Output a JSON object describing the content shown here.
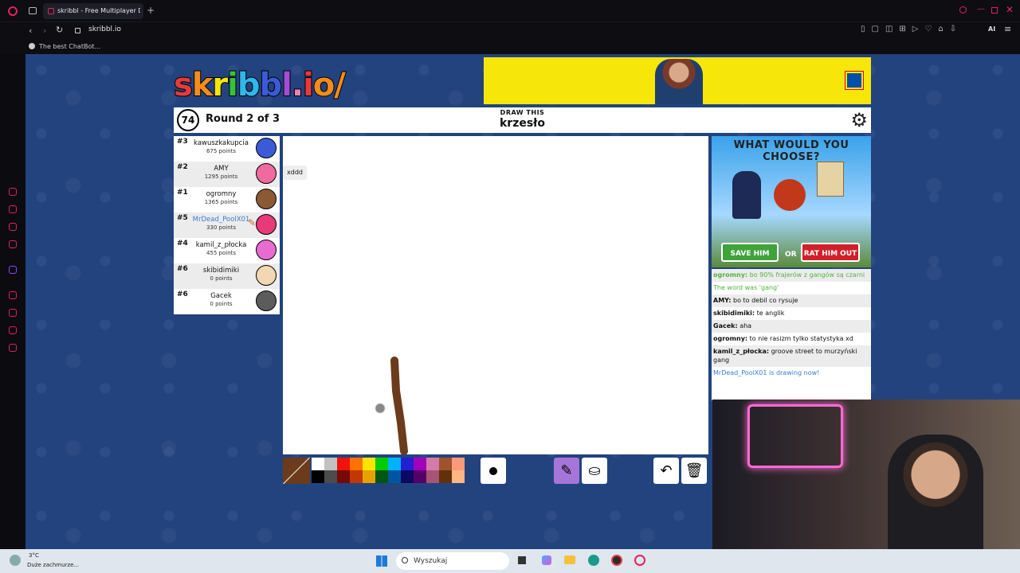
{
  "browser": {
    "tab_title": "skribbl - Free Multiplayer D",
    "url": "skribbl.io",
    "bookmark": "The best ChatBot..."
  },
  "logo": "skribbl.io",
  "game": {
    "timer": "74",
    "round": "Round 2 of 3",
    "draw_label": "DRAW THIS",
    "word": "krzesło"
  },
  "players": [
    {
      "rank": "#3",
      "name": "kawuszkakupcia",
      "points": "675 points",
      "color": "#3b5bd6"
    },
    {
      "rank": "#2",
      "name": "AMY",
      "points": "1295 points",
      "color": "#f06aa0"
    },
    {
      "rank": "#1",
      "name": "ogromny",
      "points": "1365 points",
      "color": "#8a5a35"
    },
    {
      "rank": "#5",
      "name": "MrDead_PoolX01",
      "points": "330 points",
      "color": "#e83a7a"
    },
    {
      "rank": "#4",
      "name": "kamil_z_płocka",
      "points": "455 points",
      "color": "#e86bd0"
    },
    {
      "rank": "#6",
      "name": "skibidimiki",
      "points": "0 points",
      "color": "#f3d7b2"
    },
    {
      "rank": "#6",
      "name": "Gacek",
      "points": "0 points",
      "color": "#5c5c5c"
    }
  ],
  "bubble": "xddd",
  "ad": {
    "title": "WHAT WOULD YOU CHOOSE?",
    "btn_left": "SAVE HIM",
    "or": "OR",
    "btn_right": "RAT HIM OUT"
  },
  "chat": [
    {
      "user": "ogromny:",
      "text": "bo 90% frajerów z gangów są czarni",
      "style": "green"
    },
    {
      "user": "",
      "text": "The word was 'gang'",
      "style": "green"
    },
    {
      "user": "AMY:",
      "text": "bo to debil co rysuje",
      "style": ""
    },
    {
      "user": "skibidimiki:",
      "text": "te anglik",
      "style": "alt"
    },
    {
      "user": "Gacek:",
      "text": "aha",
      "style": ""
    },
    {
      "user": "ogromny:",
      "text": "to nie rasizm tylko statystyka xd",
      "style": "alt"
    },
    {
      "user": "kamil_z_płocka:",
      "text": "groove street to murzyński gang",
      "style": ""
    },
    {
      "user": "",
      "text": "MrDead_PoolX01 is drawing now!",
      "style": "blue"
    }
  ],
  "palette": {
    "row1": [
      "#ffffff",
      "#c1c1c1",
      "#ef130b",
      "#ff7100",
      "#ffe400",
      "#00cc00",
      "#00b2ff",
      "#231fd3",
      "#a300ba",
      "#d37caa",
      "#a0522d",
      "#fb9a79"
    ],
    "row2": [
      "#000000",
      "#4c4c4c",
      "#740b07",
      "#c23800",
      "#e8a200",
      "#005510",
      "#00569e",
      "#0e0865",
      "#550069",
      "#a75574",
      "#63300d",
      "#ffb584"
    ]
  },
  "taskbar": {
    "weather_temp": "3°C",
    "weather_desc": "Duże zachmurze...",
    "search_placeholder": "Wyszukaj"
  }
}
